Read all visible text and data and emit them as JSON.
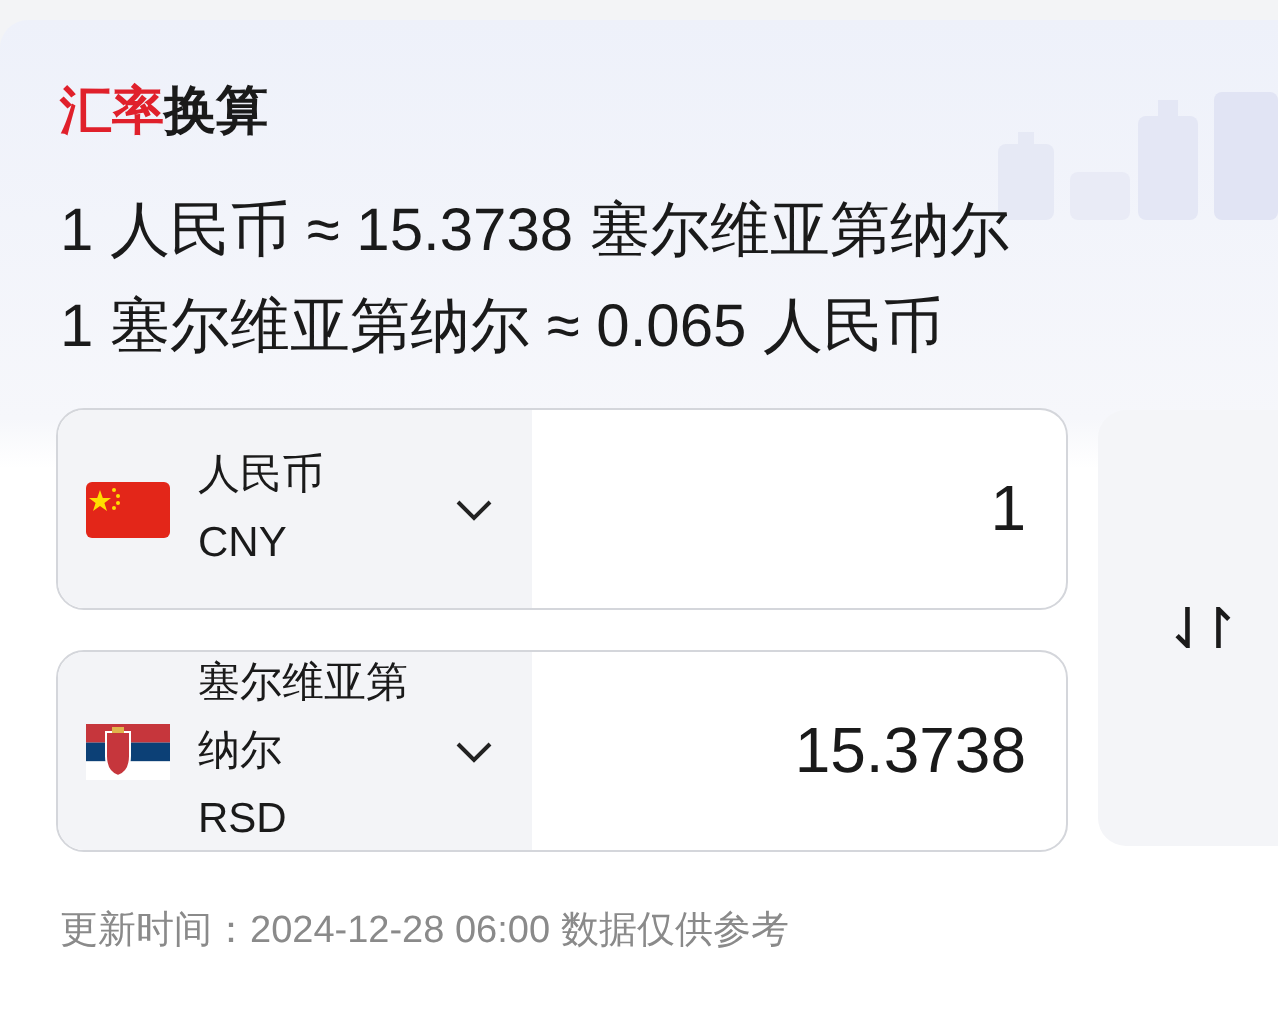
{
  "title": {
    "accent": "汇率",
    "rest": "换算"
  },
  "rates": [
    "1 人民币 ≈ 15.3738 塞尔维亚第纳尔",
    "1 塞尔维亚第纳尔 ≈ 0.065 人民币"
  ],
  "currencies": [
    {
      "kind": "cn",
      "name": "人民币",
      "code": "CNY",
      "amount": "1"
    },
    {
      "kind": "rs",
      "name": "塞尔维亚第纳尔",
      "code": "RSD",
      "amount": "15.3738"
    }
  ],
  "swap": "⇃↾",
  "footer": "更新时间：2024-12-28 06:00 数据仅供参考"
}
